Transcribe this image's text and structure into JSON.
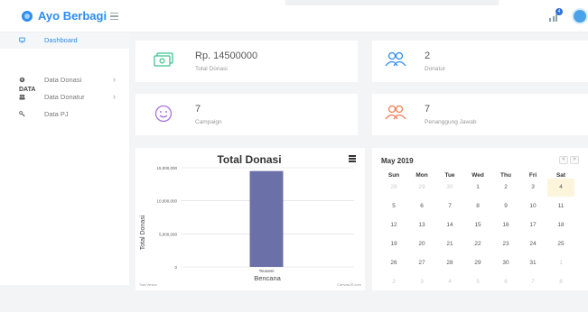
{
  "header": {
    "brand": "Ayo Berbagi",
    "mail_badge": "4"
  },
  "sidebar": {
    "dashboard_label": "Dashboard",
    "section_label": "DATA",
    "items": [
      {
        "label": "Data Donasi"
      },
      {
        "label": "Data Donatur"
      },
      {
        "label": "Data PJ"
      }
    ]
  },
  "stats": {
    "donasi_value": "Rp. 14500000",
    "donasi_label": "Total Donasi",
    "donatur_value": "2",
    "donatur_label": "Donatur",
    "campaign_value": "7",
    "campaign_label": "Campaign",
    "pj_value": "7",
    "pj_label": "Penanggung Jawab"
  },
  "chart_data": {
    "type": "bar",
    "title": "Total Donasi",
    "xlabel": "Bencana",
    "ylabel": "Total Donasi",
    "categories": [
      "Tsunami"
    ],
    "values": [
      14500000
    ],
    "ylim": [
      0,
      15000000
    ],
    "yticks": [
      "0",
      "5,000,000",
      "10,000,000",
      "15,000,000"
    ],
    "grid": true,
    "legend": "none",
    "bar_color": "#6b70a8",
    "footer_left": "Total Version",
    "footer_right": "CanvasJS.com"
  },
  "calendar": {
    "title": "May 2019",
    "prev": "<",
    "next": ">",
    "days_of_week": [
      "Sun",
      "Mon",
      "Tue",
      "Wed",
      "Thu",
      "Fri",
      "Sat"
    ],
    "weeks": [
      [
        "28",
        "29",
        "30",
        "1",
        "2",
        "3",
        "4"
      ],
      [
        "5",
        "6",
        "7",
        "8",
        "9",
        "10",
        "11"
      ],
      [
        "12",
        "13",
        "14",
        "15",
        "16",
        "17",
        "18"
      ],
      [
        "19",
        "20",
        "21",
        "22",
        "23",
        "24",
        "25"
      ],
      [
        "26",
        "27",
        "28",
        "29",
        "30",
        "31",
        "1"
      ],
      [
        "2",
        "3",
        "4",
        "5",
        "6",
        "7",
        "8"
      ]
    ],
    "today": "4"
  }
}
